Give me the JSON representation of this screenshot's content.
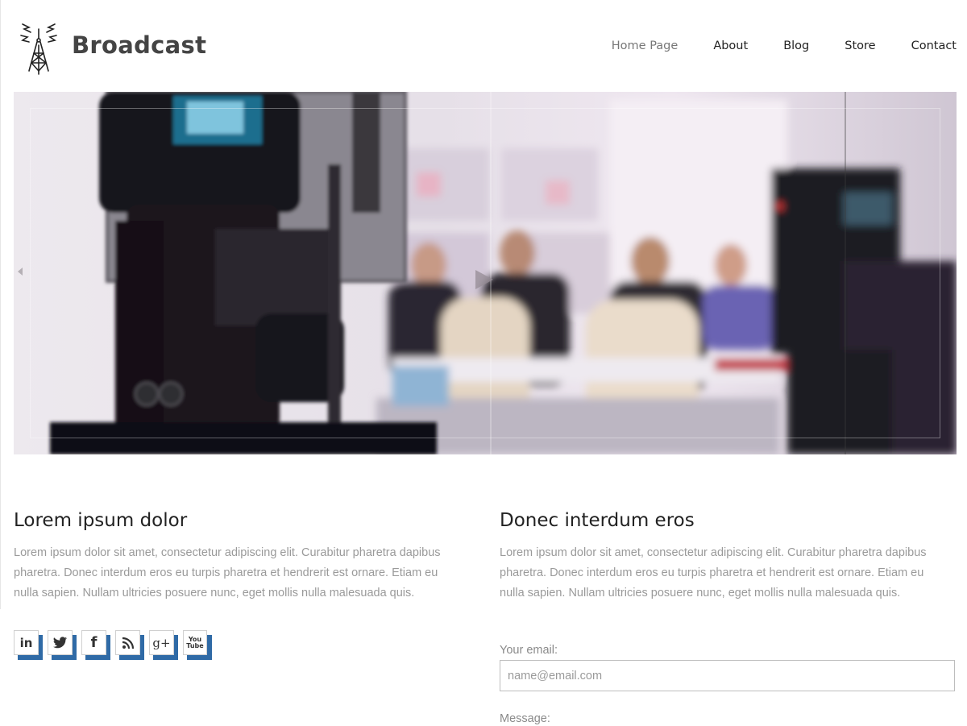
{
  "header": {
    "brand": "Broadcast",
    "nav": [
      "Home Page",
      "About",
      "Blog",
      "Store",
      "Contact"
    ],
    "active_nav": "Home Page"
  },
  "columns": [
    {
      "title": "Lorem ipsum dolor",
      "text": "Lorem ipsum dolor sit amet, consectetur adipiscing elit. Curabitur pharetra dapibus pharetra. Donec interdum eros eu turpis pharetra et hendrerit est ornare. Etiam eu nulla sapien. Nullam ultricies posuere nunc, eget mollis nulla malesuada quis."
    },
    {
      "title": "Donec interdum eros",
      "text": "Lorem ipsum dolor sit amet, consectetur adipiscing elit. Curabitur pharetra dapibus pharetra. Donec interdum eros eu turpis pharetra et hendrerit est ornare. Etiam eu nulla sapien. Nullam ultricies posuere nunc, eget mollis nulla malesuada quis."
    }
  ],
  "social": [
    {
      "icon": "linkedin-icon",
      "glyph": "in"
    },
    {
      "icon": "twitter-icon",
      "glyph": "🐦"
    },
    {
      "icon": "facebook-icon",
      "glyph": "f"
    },
    {
      "icon": "rss-icon",
      "glyph": "rss"
    },
    {
      "icon": "google-plus-icon",
      "glyph": "g+"
    },
    {
      "icon": "youtube-icon",
      "glyph": "You Tube"
    }
  ],
  "form": {
    "email_label": "Your email:",
    "email_placeholder": "name@email.com",
    "message_label": "Message:"
  },
  "colors": {
    "social_shadow": "#2f6aa6",
    "body_text": "#9a9a9a"
  }
}
